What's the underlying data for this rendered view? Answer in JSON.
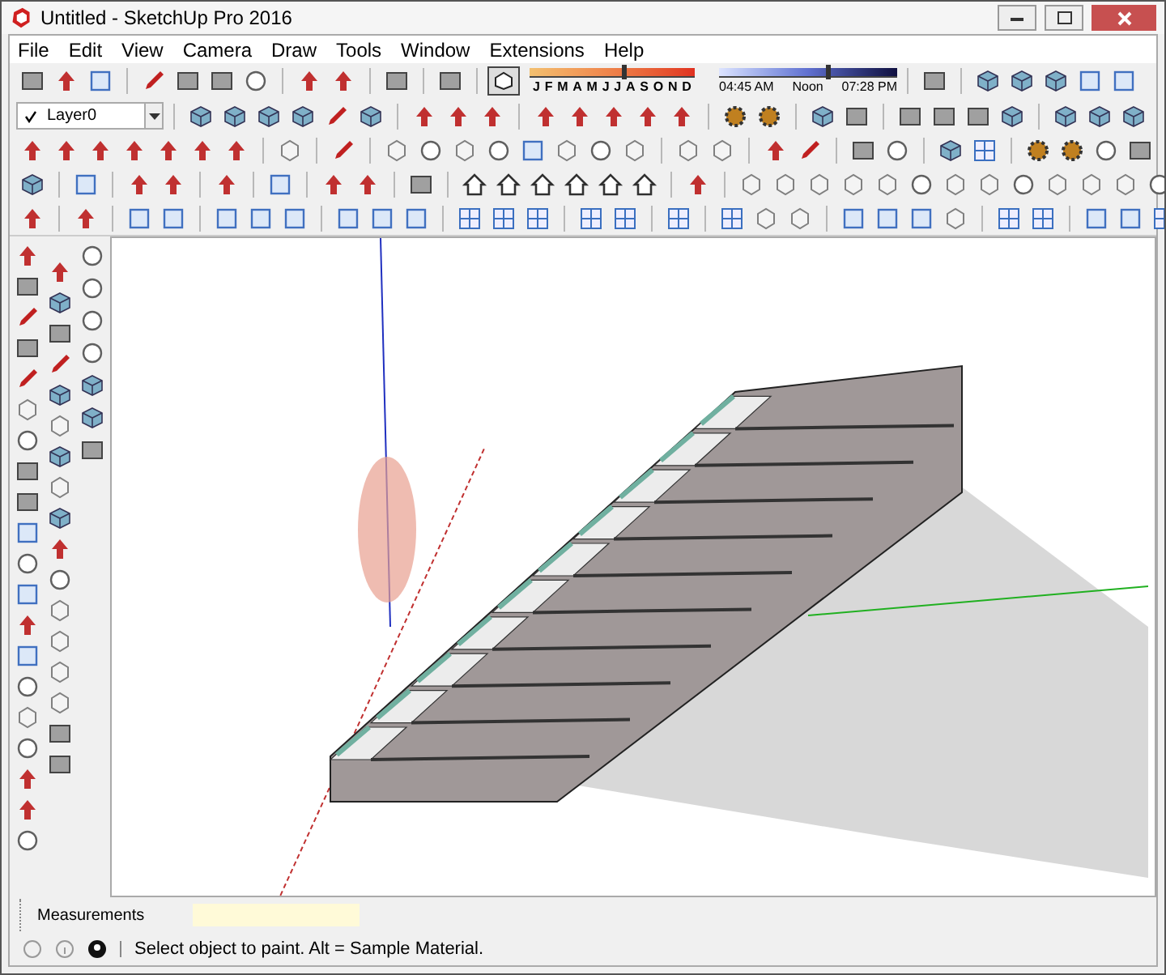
{
  "window": {
    "title": "Untitled - SketchUp Pro 2016"
  },
  "menu": [
    "File",
    "Edit",
    "View",
    "Camera",
    "Draw",
    "Tools",
    "Window",
    "Extensions",
    "Help"
  ],
  "shadow_settings": {
    "on": true,
    "months": [
      "J",
      "F",
      "M",
      "A",
      "M",
      "J",
      "J",
      "A",
      "S",
      "O",
      "N",
      "D"
    ],
    "date_slider": {
      "level": 0.56
    },
    "times": [
      "04:45 AM",
      "Noon",
      "07:28 PM"
    ],
    "time_slider": {
      "level": 0.6
    }
  },
  "layer_dropdown": {
    "value": "Layer0"
  },
  "measurements": {
    "label": "Measurements"
  },
  "status_bar": {
    "message": "Select object to paint. Alt = Sample Material."
  }
}
